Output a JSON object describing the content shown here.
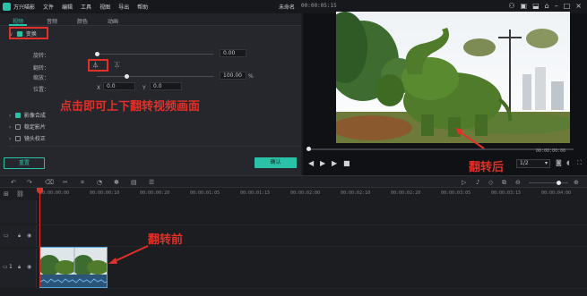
{
  "topbar": {
    "app_title": "万兴喵影",
    "menu": [
      "文件",
      "编辑",
      "工具",
      "视图",
      "导出",
      "帮助"
    ],
    "project_title": "未命名",
    "time": "00:00:05:15"
  },
  "tabs": [
    "视频",
    "音频",
    "颜色",
    "动画"
  ],
  "transform": {
    "section_label": "变换",
    "rotate_label": "旋转：",
    "rotate_value": "0.00",
    "flip_label": "翻转：",
    "scale_label": "缩放：",
    "scale_value": "100.00",
    "scale_unit": "%",
    "position_label": "位置：",
    "x_label": "X",
    "x_value": "0.0",
    "y_label": "Y",
    "y_value": "0.0"
  },
  "sections": [
    "影像合成",
    "稳定影片",
    "镜头校正"
  ],
  "buttons": {
    "reset": "重置",
    "ok": "确认"
  },
  "preview": {
    "timecode": "00:00:00:00",
    "quality": "1/2"
  },
  "annotations": {
    "flip_hint": "点击即可上下翻转视频画面",
    "after": "翻转后",
    "before": "翻转前"
  },
  "ruler": [
    "00:00:00:00",
    "00:00:00:10",
    "00:00:00:20",
    "00:00:01:05",
    "00:00:01:15",
    "00:00:02:00",
    "00:00:02:10",
    "00:00:02:20",
    "00:00:03:05",
    "00:00:03:15",
    "00:00:04:00"
  ],
  "tracks": {
    "video_track_1": "1"
  },
  "colors": {
    "accent": "#29c2a7",
    "annotation_red": "#e0302a",
    "clip_blue": "#4ea3e0"
  }
}
